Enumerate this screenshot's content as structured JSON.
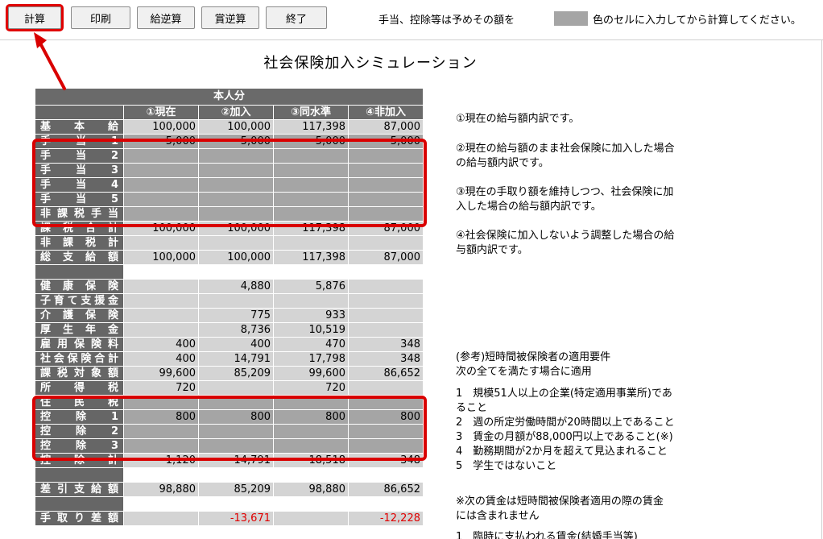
{
  "toolbar": {
    "buttons": [
      "計算",
      "印刷",
      "給逆算",
      "賞逆算",
      "終了"
    ],
    "note_left": "手当、控除等は予めその額を",
    "note_right": "色のセルに入力してから計算してください。"
  },
  "title": "社会保険加入シミュレーション",
  "table": {
    "section_header": "本人分",
    "columns": [
      "①現在",
      "②加入",
      "③同水準",
      "④非加入"
    ],
    "rows": [
      {
        "label": "基本給",
        "values": [
          "100,000",
          "100,000",
          "117,398",
          "87,000"
        ]
      },
      {
        "label": "手当1",
        "values": [
          "5,000",
          "5,000",
          "5,000",
          "5,000"
        ]
      },
      {
        "label": "手当2",
        "values": [
          "",
          "",
          "",
          ""
        ]
      },
      {
        "label": "手当3",
        "values": [
          "",
          "",
          "",
          ""
        ]
      },
      {
        "label": "手当4",
        "values": [
          "",
          "",
          "",
          ""
        ]
      },
      {
        "label": "手当5",
        "values": [
          "",
          "",
          "",
          ""
        ]
      },
      {
        "label": "非課税手当",
        "values": [
          "",
          "",
          "",
          ""
        ]
      },
      {
        "label": "課税合計",
        "values": [
          "100,000",
          "100,000",
          "117,398",
          "87,000"
        ]
      },
      {
        "label": "非課税計",
        "values": [
          "",
          "",
          "",
          ""
        ]
      },
      {
        "label": "総支給額",
        "values": [
          "100,000",
          "100,000",
          "117,398",
          "87,000"
        ]
      },
      {
        "label": "",
        "values": [
          "",
          "",
          "",
          ""
        ]
      },
      {
        "label": "健康保険",
        "values": [
          "",
          "4,880",
          "5,876",
          ""
        ]
      },
      {
        "label": "子育て支援金",
        "values": [
          "",
          "",
          "",
          ""
        ]
      },
      {
        "label": "介護保険",
        "values": [
          "",
          "775",
          "933",
          ""
        ]
      },
      {
        "label": "厚生年金",
        "values": [
          "",
          "8,736",
          "10,519",
          ""
        ]
      },
      {
        "label": "雇用保険料",
        "values": [
          "400",
          "400",
          "470",
          "348"
        ]
      },
      {
        "label": "社会保険合計",
        "values": [
          "400",
          "14,791",
          "17,798",
          "348"
        ]
      },
      {
        "label": "課税対象額",
        "values": [
          "99,600",
          "85,209",
          "99,600",
          "86,652"
        ]
      },
      {
        "label": "所得税",
        "values": [
          "720",
          "",
          "720",
          ""
        ]
      },
      {
        "label": "住民税",
        "values": [
          "",
          "",
          "",
          ""
        ]
      },
      {
        "label": "控除1",
        "values": [
          "800",
          "800",
          "800",
          "800"
        ]
      },
      {
        "label": "控除2",
        "values": [
          "",
          "",
          "",
          ""
        ]
      },
      {
        "label": "控除3",
        "values": [
          "",
          "",
          "",
          ""
        ]
      },
      {
        "label": "控除計",
        "values": [
          "1,120",
          "14,791",
          "18,518",
          "348"
        ]
      },
      {
        "label": "",
        "values": [
          "",
          "",
          "",
          ""
        ]
      },
      {
        "label": "差引支給額",
        "values": [
          "98,880",
          "85,209",
          "98,880",
          "86,652"
        ]
      },
      {
        "label": "",
        "values": [
          "",
          "",
          "",
          ""
        ]
      },
      {
        "label": "手取り差額",
        "values": [
          "",
          "-13,671",
          "",
          "-12,228"
        ]
      }
    ]
  },
  "explanations": {
    "e1": [
      "①現在の給与額内訳です。"
    ],
    "e2": [
      "②現在の給与額のまま社会保険に加入した場合",
      "の給与額内訳です。"
    ],
    "e3": [
      "③現在の手取り額を維持しつつ、社会保険に加",
      "入した場合の給与額内訳です。"
    ],
    "e4": [
      "④社会保険に加入しないよう調整した場合の給",
      "与額内訳です。"
    ],
    "ref_title": [
      "(参考)短時間被保険者の適用要件",
      "次の全てを満たす場合に適用"
    ],
    "ref_items": [
      "1　規模51人以上の企業(特定適用事業所)であ",
      "ること",
      "2　週の所定労働時間が20時間以上であること",
      "3　賃金の月額が88,000円以上であること(※)",
      "4　勤務期間が2か月を超えて見込まれること",
      "5　学生ではないこと"
    ],
    "note": [
      "※次の賃金は短時間被保険者適用の際の賃金",
      "には含まれません"
    ],
    "cut": [
      "1　臨時に支払われる賃金(結婚手当等)"
    ]
  },
  "colors": {
    "accent_red": "#d90000",
    "input_gray": "#a5a5a5",
    "label_gray": "#666666",
    "cell_gray": "#d4d4d4"
  }
}
